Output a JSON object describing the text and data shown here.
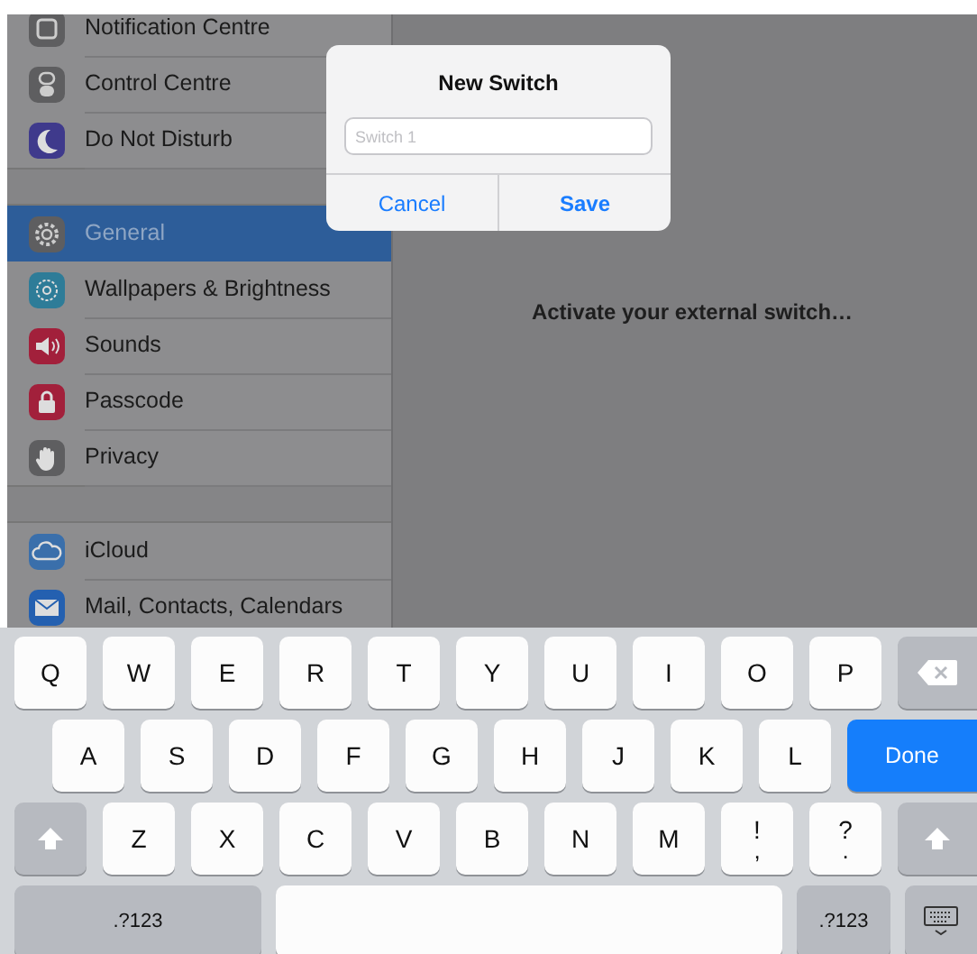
{
  "sidebar": {
    "groups": [
      {
        "items": [
          {
            "label": "Notification Centre",
            "kind": "notifications",
            "color": "#5e5e60",
            "selected": false
          },
          {
            "label": "Control Centre",
            "kind": "toggles",
            "color": "#5e5e60",
            "selected": false
          },
          {
            "label": "Do Not Disturb",
            "kind": "moon",
            "color": "#3f3a8c",
            "selected": false
          }
        ]
      },
      {
        "items": [
          {
            "label": "General",
            "kind": "gear",
            "color": "#5e5e60",
            "selected": true
          },
          {
            "label": "Wallpapers & Brightness",
            "kind": "flower",
            "color": "#2e7c98",
            "selected": false
          },
          {
            "label": "Sounds",
            "kind": "speaker",
            "color": "#a2203b",
            "selected": false
          },
          {
            "label": "Passcode",
            "kind": "lock",
            "color": "#a2203b",
            "selected": false
          },
          {
            "label": "Privacy",
            "kind": "hand",
            "color": "#5e5e60",
            "selected": false
          }
        ]
      },
      {
        "items": [
          {
            "label": "iCloud",
            "kind": "cloud",
            "color": "#3a6fab",
            "selected": false
          },
          {
            "label": "Mail, Contacts, Calendars",
            "kind": "envelope",
            "color": "#2460b0",
            "selected": false
          }
        ]
      }
    ]
  },
  "detail": {
    "message": "Activate your external switch…"
  },
  "dialog": {
    "title": "New Switch",
    "field": {
      "placeholder": "Switch 1"
    },
    "buttons": [
      {
        "label": "Cancel",
        "kind": "normal"
      },
      {
        "label": "Save",
        "kind": "default"
      }
    ]
  },
  "keyboard": {
    "rows": [
      {
        "keys": [
          {
            "kind": "letter",
            "label": "Q"
          },
          {
            "kind": "letter",
            "label": "W"
          },
          {
            "kind": "letter",
            "label": "E"
          },
          {
            "kind": "letter",
            "label": "R"
          },
          {
            "kind": "letter",
            "label": "T"
          },
          {
            "kind": "letter",
            "label": "Y"
          },
          {
            "kind": "letter",
            "label": "U"
          },
          {
            "kind": "letter",
            "label": "I"
          },
          {
            "kind": "letter",
            "label": "O"
          },
          {
            "kind": "letter",
            "label": "P"
          },
          {
            "kind": "delete"
          }
        ]
      },
      {
        "keys": [
          {
            "kind": "letter",
            "label": "A"
          },
          {
            "kind": "letter",
            "label": "S"
          },
          {
            "kind": "letter",
            "label": "D"
          },
          {
            "kind": "letter",
            "label": "F"
          },
          {
            "kind": "letter",
            "label": "G"
          },
          {
            "kind": "letter",
            "label": "H"
          },
          {
            "kind": "letter",
            "label": "J"
          },
          {
            "kind": "letter",
            "label": "K"
          },
          {
            "kind": "letter",
            "label": "L"
          },
          {
            "kind": "done",
            "label": "Done"
          }
        ]
      },
      {
        "keys": [
          {
            "kind": "shift"
          },
          {
            "kind": "letter",
            "label": "Z"
          },
          {
            "kind": "letter",
            "label": "X"
          },
          {
            "kind": "letter",
            "label": "C"
          },
          {
            "kind": "letter",
            "label": "V"
          },
          {
            "kind": "letter",
            "label": "B"
          },
          {
            "kind": "letter",
            "label": "N"
          },
          {
            "kind": "letter",
            "label": "M"
          },
          {
            "kind": "punct",
            "label": "!",
            "sub": ","
          },
          {
            "kind": "punct",
            "label": "?",
            "sub": "."
          },
          {
            "kind": "shift"
          }
        ]
      },
      {
        "keys": [
          {
            "kind": "mode",
            "label": ".?123"
          },
          {
            "kind": "space"
          },
          {
            "kind": "mode",
            "label": ".?123"
          },
          {
            "kind": "dismiss"
          }
        ]
      }
    ]
  }
}
